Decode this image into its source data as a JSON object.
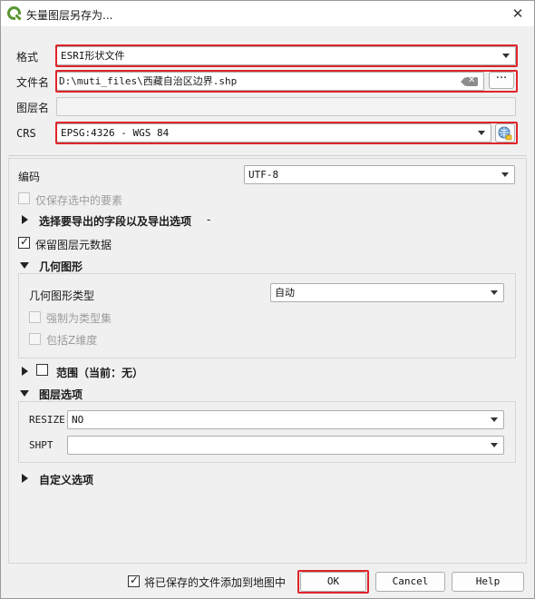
{
  "window": {
    "title": "矢量图层另存为..."
  },
  "fields": {
    "format_label": "格式",
    "format_value": "ESRI形状文件",
    "filename_label": "文件名",
    "filename_value": "D:\\muti_files\\西藏自治区边界.shp",
    "browse_label": "···",
    "layername_label": "图层名",
    "layername_value": "",
    "crs_label": "CRS",
    "crs_value": "EPSG:4326 - WGS 84"
  },
  "options": {
    "encoding_label": "编码",
    "encoding_value": "UTF-8",
    "save_selected_label": "仅保存选中的要素",
    "save_selected_checked": false,
    "fields_section": "选择要导出的字段以及导出选项",
    "fields_section_suffix": "-",
    "keep_metadata_label": "保留图层元数据",
    "keep_metadata_checked": true
  },
  "geometry": {
    "section": "几何图形",
    "type_label": "几何图形类型",
    "type_value": "自动",
    "force_multi_label": "强制为类型集",
    "include_z_label": "包括Z维度"
  },
  "extent": {
    "section": "范围（当前：无）",
    "checked": false
  },
  "layer_options": {
    "section": "图层选项",
    "rows": [
      {
        "key": "RESIZE",
        "value": "NO"
      },
      {
        "key": "SHPT",
        "value": ""
      }
    ]
  },
  "custom": {
    "section": "自定义选项"
  },
  "footer": {
    "add_to_map_label": "将已保存的文件添加到地图中",
    "add_to_map_checked": true,
    "ok": "OK",
    "cancel": "Cancel",
    "help": "Help"
  },
  "colors": {
    "highlight": "#e0242a",
    "qgis_green": "#589632"
  }
}
